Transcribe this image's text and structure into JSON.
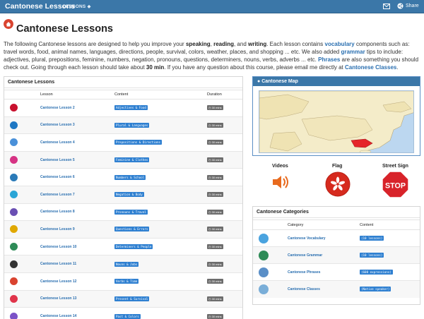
{
  "navbar": {
    "brand": "Cantonese Lessons",
    "lessons_menu": "LESSONS ◆",
    "share": "Share"
  },
  "header": {
    "title": "Cantonese Lessons"
  },
  "intro": {
    "p1": "The following Cantonese lessons are designed to help you improve your ",
    "speaking": "speaking",
    "comma1": ", ",
    "reading": "reading",
    "and": ", and ",
    "writing": "writing",
    "p2": ". Each lesson contains ",
    "vocabulary": "vocabulary",
    "p3": " components such as: travel words, food, animal names, languages, directions, people, survival, colors, weather, places, and shopping ... etc. We also added ",
    "grammar": "grammar",
    "p4": " tips to include: adjectives, plural, prepositions, feminine, numbers, negation, pronouns, questions, determiners, nouns, verbs, adverbs ... etc. ",
    "phrases": "Phrases",
    "p5": " are also something you should check out. Going through each lesson should take about ",
    "minutes": "30 min",
    "p6": ". If you have any question about this course, please email me directly at ",
    "classes": "Cantonese Classes",
    "p7": "."
  },
  "lessons": {
    "heading": "Cantonese Lessons",
    "columns": [
      "Lesson",
      "Content",
      "Duration"
    ],
    "rows": [
      {
        "icon": "cherries-icon",
        "color": "#c8102e",
        "name": "Cantonese Lesson 2",
        "content": "Adjectives & Food",
        "duration": "30 mins"
      },
      {
        "icon": "globe-icon",
        "color": "#1e77c3",
        "name": "Cantonese Lesson 3",
        "content": "Plural & Languages",
        "duration": "30 mins"
      },
      {
        "icon": "signpost-icon",
        "color": "#4a90d9",
        "name": "Cantonese Lesson 4",
        "content": "Prepositions & Directions",
        "duration": "30 mins"
      },
      {
        "icon": "woman-icon",
        "color": "#d63384",
        "name": "Cantonese Lesson 5",
        "content": "Feminine & Clothes",
        "duration": "30 mins"
      },
      {
        "icon": "school-icon",
        "color": "#2a7ab8",
        "name": "Cantonese Lesson 6",
        "content": "Numbers & School",
        "duration": "30 mins"
      },
      {
        "icon": "body-icon",
        "color": "#2aa5d6",
        "name": "Cantonese Lesson 7",
        "content": "Negation & Body",
        "duration": "30 mins"
      },
      {
        "icon": "travel-icon",
        "color": "#6a4fb3",
        "name": "Cantonese Lesson 8",
        "content": "Pronouns & Travel",
        "duration": "30 mins"
      },
      {
        "icon": "chat-icon",
        "color": "#e0a800",
        "name": "Cantonese Lesson 9",
        "content": "Questions & Errors",
        "duration": "30 mins"
      },
      {
        "icon": "people-icon",
        "color": "#2e8b57",
        "name": "Cantonese Lesson 10",
        "content": "Determiners & People",
        "duration": "30 mins"
      },
      {
        "icon": "worker-icon",
        "color": "#333333",
        "name": "Cantonese Lesson 11",
        "content": "Nouns & Jobs",
        "duration": "30 mins"
      },
      {
        "icon": "calendar-icon",
        "color": "#d9432f",
        "name": "Cantonese Lesson 12",
        "content": "Verbs & Time",
        "duration": "30 mins"
      },
      {
        "icon": "heart-icon",
        "color": "#e0344a",
        "name": "Cantonese Lesson 13",
        "content": "Present & Survival",
        "duration": "30 mins"
      },
      {
        "icon": "palette-icon",
        "color": "#7b52c7",
        "name": "Cantonese Lesson 14",
        "content": "Past & Colors",
        "duration": "30 mins"
      }
    ]
  },
  "map": {
    "heading": "Cantonese Map"
  },
  "media": {
    "videos": "Videos",
    "flag": "Flag",
    "street_sign": "Street Sign",
    "stop_text": "STOP"
  },
  "categories": {
    "heading": "Cantonese Categories",
    "columns": [
      "Category",
      "Content"
    ],
    "rows": [
      {
        "icon": "vocabulary-icon",
        "color": "#4aa3df",
        "name": "Cantonese Vocabulary",
        "content": "(10 lessons)"
      },
      {
        "icon": "grammar-icon",
        "color": "#2e8b57",
        "name": "Cantonese Grammar",
        "content": "(10 lessons)"
      },
      {
        "icon": "phrases-icon",
        "color": "#5a8fc7",
        "name": "Cantonese Phrases",
        "content": "(600 expressions)"
      },
      {
        "icon": "classes-icon",
        "color": "#7aaed8",
        "name": "Cantonese Classes",
        "content": "(Native speaker)"
      }
    ]
  }
}
